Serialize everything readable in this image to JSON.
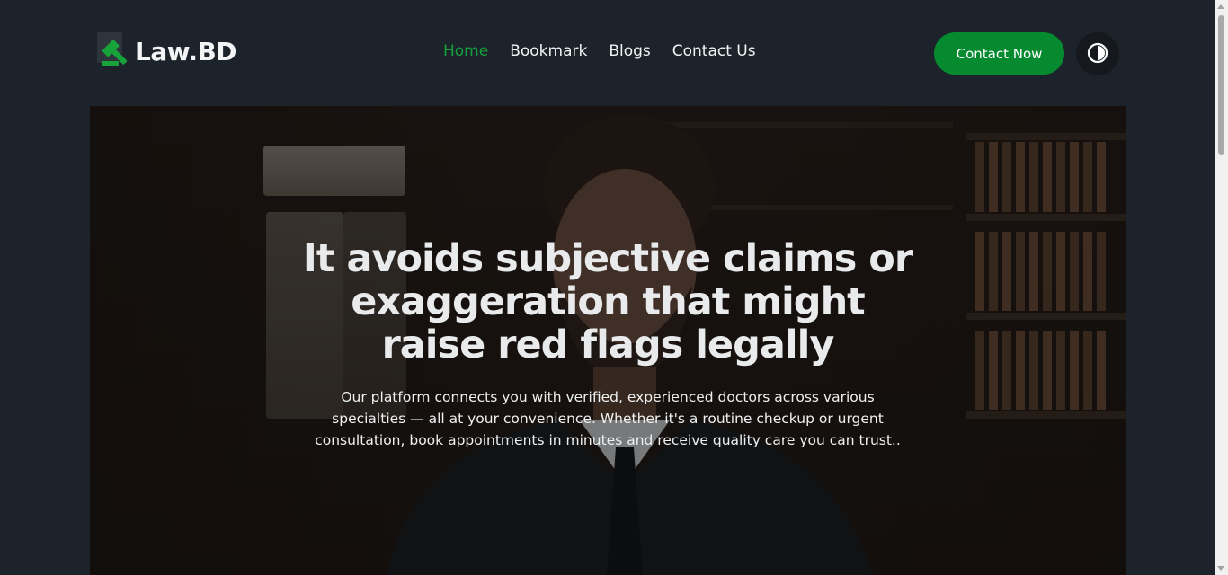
{
  "brand": {
    "name": "Law.BD",
    "logo_icon": "gavel-icon",
    "accent_color": "#058a2f"
  },
  "nav": {
    "items": [
      {
        "label": "Home",
        "active": true
      },
      {
        "label": "Bookmark",
        "active": false
      },
      {
        "label": "Blogs",
        "active": false
      },
      {
        "label": "Contact Us",
        "active": false
      }
    ],
    "cta_label": "Contact Now",
    "theme_toggle_icon": "contrast-toggle-icon"
  },
  "hero": {
    "title": "It avoids subjective claims or exaggeration that might raise red flags legally",
    "text": "Our platform connects you with verified, experienced doctors across various specialties — all at your convenience. Whether it's a routine checkup or urgent consultation, book appointments in minutes and receive quality care you can trust..",
    "background_image": "lawyer-in-library-photo"
  }
}
